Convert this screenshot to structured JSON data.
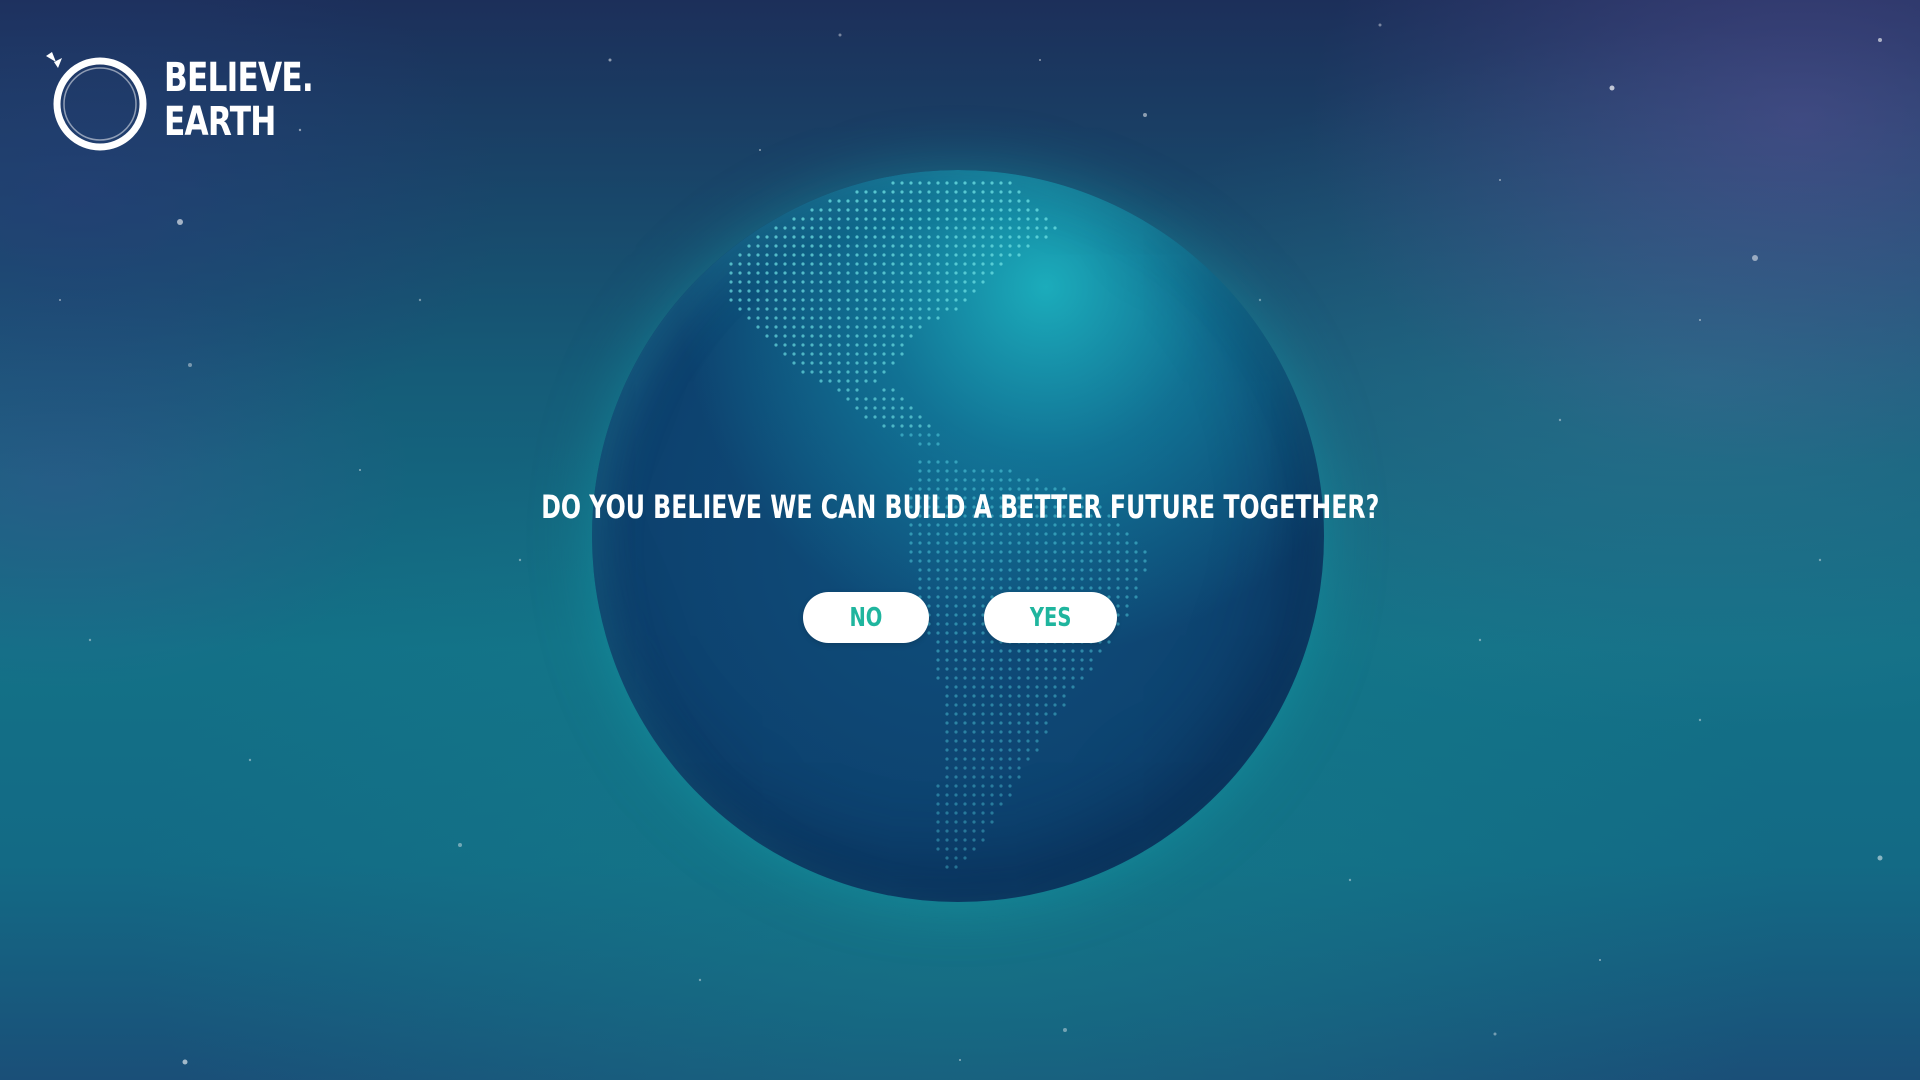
{
  "brand": {
    "line1": "BELIEVE.",
    "line2": "EARTH"
  },
  "prompt": {
    "question": "DO YOU BELIEVE WE CAN BUILD A BETTER FUTURE TOGETHER?"
  },
  "actions": {
    "no_label": "NO",
    "yes_label": "YES"
  },
  "colors": {
    "button_text": "#1fb59e",
    "button_bg": "#ffffff",
    "globe_dark": "#0d426f",
    "globe_highlight": "#1ebec8"
  },
  "icons": {
    "logo": "believe-earth-ring-logo",
    "globe": "dotted-globe-americas"
  }
}
